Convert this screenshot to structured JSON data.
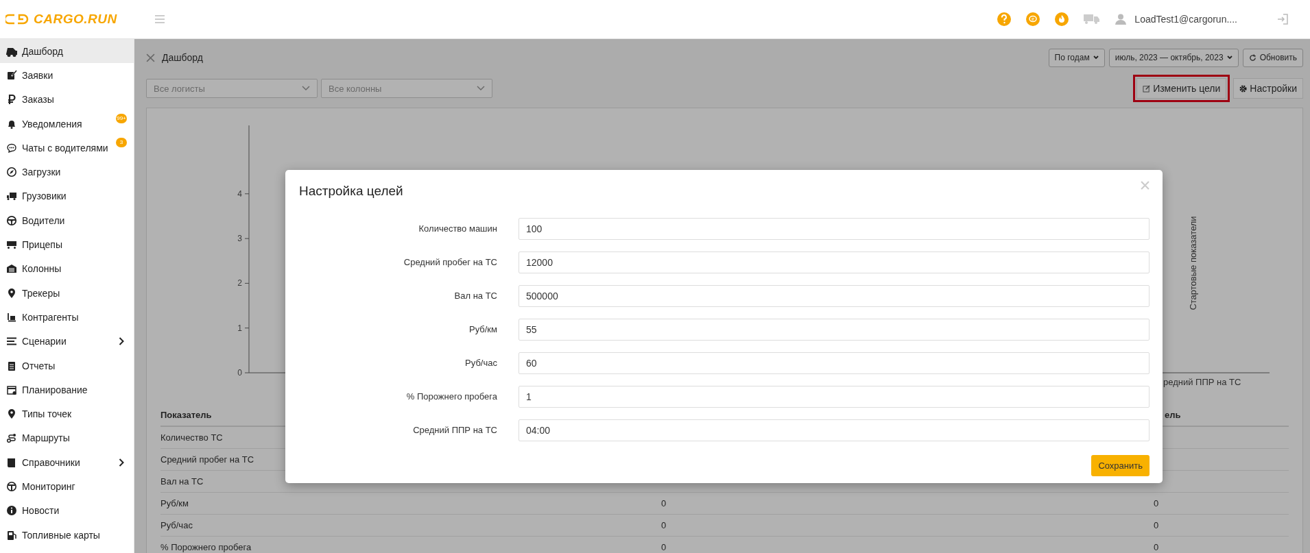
{
  "topbar": {
    "logo": "CARGO.RUN",
    "user": "LoadTest1@cargorun...."
  },
  "sidebar": {
    "items": [
      {
        "label": "Дашборд",
        "selected": true,
        "expandable": false
      },
      {
        "label": "Заявки",
        "selected": false,
        "expandable": false
      },
      {
        "label": "Заказы",
        "selected": false,
        "expandable": false
      },
      {
        "label": "Уведомления",
        "selected": false,
        "expandable": false,
        "badge": "99+"
      },
      {
        "label": "Чаты с водителями",
        "selected": false,
        "expandable": false,
        "badge": "3"
      },
      {
        "label": "Загрузки",
        "selected": false,
        "expandable": false
      },
      {
        "label": "Грузовики",
        "selected": false,
        "expandable": false
      },
      {
        "label": "Водители",
        "selected": false,
        "expandable": false
      },
      {
        "label": "Прицепы",
        "selected": false,
        "expandable": false
      },
      {
        "label": "Колонны",
        "selected": false,
        "expandable": false
      },
      {
        "label": "Трекеры",
        "selected": false,
        "expandable": false
      },
      {
        "label": "Контрагенты",
        "selected": false,
        "expandable": false
      },
      {
        "label": "Сценарии",
        "selected": false,
        "expandable": true
      },
      {
        "label": "Отчеты",
        "selected": false,
        "expandable": false
      },
      {
        "label": "Планирование",
        "selected": false,
        "expandable": false
      },
      {
        "label": "Типы точек",
        "selected": false,
        "expandable": false
      },
      {
        "label": "Маршруты",
        "selected": false,
        "expandable": false
      },
      {
        "label": "Справочники",
        "selected": false,
        "expandable": true
      },
      {
        "label": "Мониторинг",
        "selected": false,
        "expandable": false
      },
      {
        "label": "Новости",
        "selected": false,
        "expandable": false
      },
      {
        "label": "Топливные карты",
        "selected": false,
        "expandable": false
      }
    ]
  },
  "header": {
    "title": "Дашборд",
    "period_mode": "По годам",
    "date_range": "июль, 2023 — октябрь, 2023",
    "refresh": "Обновить"
  },
  "filters": [
    {
      "placeholder": "Все логисты"
    },
    {
      "placeholder": "Все колонны"
    }
  ],
  "actions": [
    {
      "label": "Изменить цели",
      "highlighted": true
    },
    {
      "label": "Настройки",
      "highlighted": false
    }
  ],
  "chart": {
    "y_ticks": [
      "4",
      "3",
      "2",
      "1",
      "0"
    ],
    "x_label": "редний ППР на ТС",
    "side_label": "Стартовые показатели"
  },
  "table": {
    "header": {
      "column_1": "Показатель",
      "column_3": "ель"
    },
    "rows": [
      {
        "column_1": "Количество ТС"
      },
      {
        "column_1": "Средний пробег на ТС"
      },
      {
        "column_1": "Вал на ТС"
      },
      {
        "column_1": "Руб/км",
        "column_2": "0",
        "column_3": "0"
      },
      {
        "column_1": "Руб/час",
        "column_2": "0",
        "column_3": "0"
      },
      {
        "column_1": "% Порожнего пробега",
        "column_2": "0",
        "column_3": "0"
      }
    ]
  },
  "modal": {
    "title": "Настройка целей",
    "fields": [
      {
        "label": "Количество машин",
        "value": "100"
      },
      {
        "label": "Средний пробег на ТС",
        "value": "12000"
      },
      {
        "label": "Вал на ТС",
        "value": "500000"
      },
      {
        "label": "Руб/км",
        "value": "55"
      },
      {
        "label": "Руб/час",
        "value": "60"
      },
      {
        "label": "% Порожнего пробега",
        "value": "1"
      },
      {
        "label": "Средний ППР на ТС",
        "value": "04:00"
      }
    ],
    "save": "Сохранить"
  }
}
